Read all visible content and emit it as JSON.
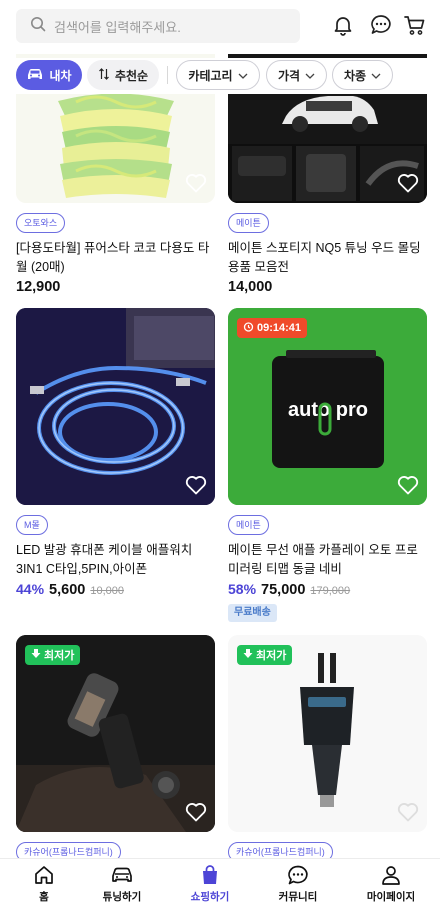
{
  "header": {
    "search_placeholder": "검색어를 입력해주세요.",
    "icons": [
      "search-icon",
      "bell-icon",
      "chat-icon",
      "cart-icon"
    ]
  },
  "filters": {
    "my_car": "내차",
    "sort": "추천순",
    "category": "카테고리",
    "price": "가격",
    "car_model": "차종"
  },
  "products": [
    {
      "brand": "오토와스",
      "name": "[다용도타월] 퓨어스타 코코 다용도 타월 (20매)",
      "price": "12,900"
    },
    {
      "brand": "메이튼",
      "name": "메이튼 스포티지 NQ5 튜닝 우드 몰딩 용품 모음전",
      "price": "14,000"
    },
    {
      "brand": "M몰",
      "name": "LED 발광 휴대폰 케이블 애플워치 3IN1 C타입,5PIN,아이폰",
      "discount": "44%",
      "price": "5,600",
      "original": "10,000"
    },
    {
      "brand": "메이튼",
      "name": "메이튼 무선 애플 카플레이 오토 프로 미러링 티맵 동글 네비",
      "discount": "58%",
      "price": "75,000",
      "original": "179,000",
      "timer": "09:14:41",
      "badge": "무료배송",
      "logo_text": "auto pro"
    },
    {
      "brand": "카슈어(프롬나드컴퍼니)",
      "label": "최저가"
    },
    {
      "brand": "카슈어(프롬나드컴퍼니)",
      "label": "최저가"
    }
  ],
  "bottom_nav": [
    {
      "label": "홈",
      "icon": "home-icon"
    },
    {
      "label": "튜닝하기",
      "icon": "car-icon"
    },
    {
      "label": "쇼핑하기",
      "icon": "shopping-bag-icon",
      "active": true
    },
    {
      "label": "커뮤니티",
      "icon": "community-icon"
    },
    {
      "label": "마이페이지",
      "icon": "user-icon"
    }
  ],
  "colors": {
    "accent": "#5b5ce2",
    "timer": "#f04a2a",
    "lowest": "#21c15a"
  }
}
